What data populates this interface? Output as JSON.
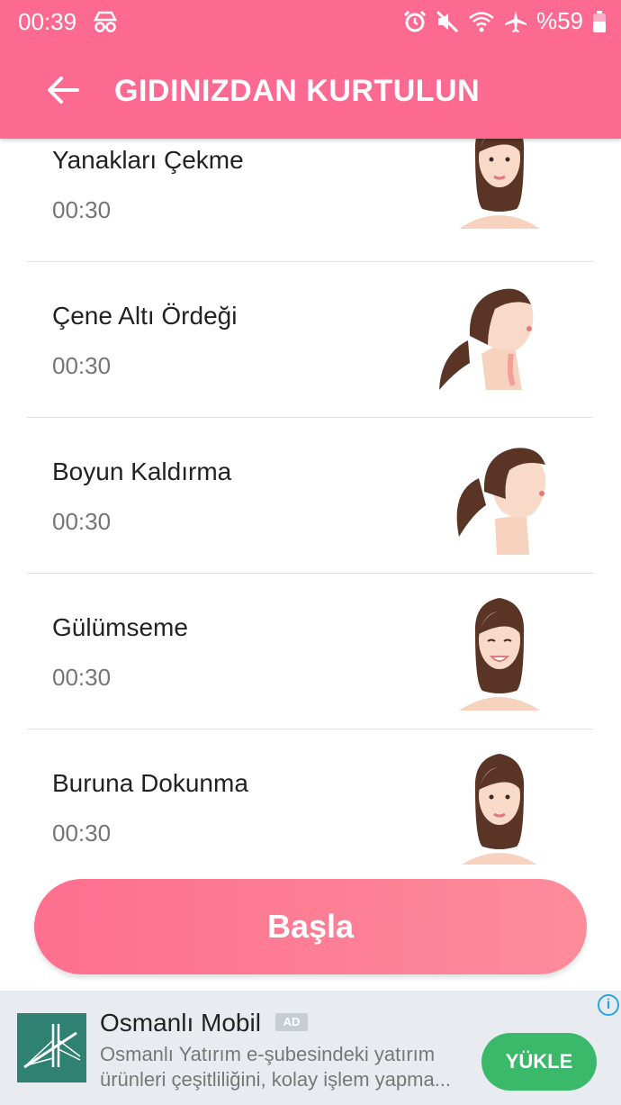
{
  "status_bar": {
    "time": "00:39",
    "battery": "%59"
  },
  "app_bar": {
    "title": "GIDINIZDAN KURTULUN"
  },
  "exercises": [
    {
      "name": "Yanakları Çekme",
      "duration": "00:30",
      "image": "face-front"
    },
    {
      "name": "Çene Altı Ördeği",
      "duration": "00:30",
      "image": "face-profile-up"
    },
    {
      "name": "Boyun Kaldırma",
      "duration": "00:30",
      "image": "face-profile"
    },
    {
      "name": "Gülümseme",
      "duration": "00:30",
      "image": "face-front-smile"
    },
    {
      "name": "Buruna Dokunma",
      "duration": "00:30",
      "image": "face-front"
    }
  ],
  "start_button": {
    "label": "Başla"
  },
  "ad": {
    "title": "Osmanlı Mobil",
    "badge": "AD",
    "description_line1": "Osmanlı Yatırım e-şubesindeki yatırım",
    "description_line2": "ürünleri çeşitliliğini, kolay işlem yapma...",
    "cta": "YÜKLE",
    "info": "i"
  },
  "colors": {
    "primary": "#fd6a91",
    "ad_cta": "#3bb96b",
    "ad_logo": "#2f8172"
  }
}
